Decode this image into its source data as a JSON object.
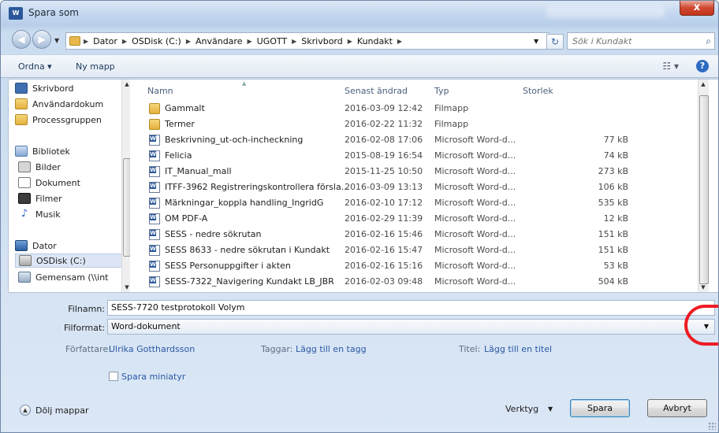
{
  "window": {
    "app_icon": "W",
    "title": "Spara som",
    "close_label": "x"
  },
  "address": {
    "crumbs": [
      "Dator",
      "OSDisk (C:)",
      "Användare",
      "UGOTT",
      "Skrivbord",
      "Kundakt"
    ],
    "search_placeholder": "Sök i Kundakt"
  },
  "toolbar": {
    "organize_label": "Ordna ▾",
    "new_folder_label": "Ny mapp"
  },
  "nav_pane": {
    "items": [
      {
        "label": "Skrivbord",
        "icon": "desktop-icon"
      },
      {
        "label": "Användardokum",
        "icon": "folder-icon"
      },
      {
        "label": "Processgruppen",
        "icon": "folder-icon"
      },
      {
        "label": "Bibliotek",
        "icon": "library-icon"
      },
      {
        "label": "Bilder",
        "icon": "pictures-icon"
      },
      {
        "label": "Dokument",
        "icon": "documents-icon"
      },
      {
        "label": "Filmer",
        "icon": "videos-icon"
      },
      {
        "label": "Musik",
        "icon": "music-icon"
      },
      {
        "label": "Dator",
        "icon": "computer-icon"
      },
      {
        "label": "OSDisk (C:)",
        "icon": "drive-icon",
        "selected": true
      },
      {
        "label": "Gemensam (\\\\int",
        "icon": "network-drive-icon"
      }
    ]
  },
  "file_list": {
    "columns": [
      "Namn",
      "Senast ändrad",
      "Typ",
      "Storlek"
    ],
    "rows": [
      {
        "name": "Gammalt",
        "date": "2016-03-09 12:42",
        "type": "Filmapp",
        "size": "",
        "kind": "folder"
      },
      {
        "name": "Termer",
        "date": "2016-02-22 11:32",
        "type": "Filmapp",
        "size": "",
        "kind": "folder"
      },
      {
        "name": "Beskrivning_ut-och-incheckning",
        "date": "2016-02-08 17:06",
        "type": "Microsoft Word-d...",
        "size": "77 kB",
        "kind": "word"
      },
      {
        "name": "Felicia",
        "date": "2015-08-19 16:54",
        "type": "Microsoft Word-d...",
        "size": "74 kB",
        "kind": "word"
      },
      {
        "name": "IT_Manual_mall",
        "date": "2015-11-25 10:50",
        "type": "Microsoft Word-d...",
        "size": "273 kB",
        "kind": "word"
      },
      {
        "name": "ITFF-3962 Registreringskontrollera försla...",
        "date": "2016-03-09 13:13",
        "type": "Microsoft Word-d...",
        "size": "106 kB",
        "kind": "word"
      },
      {
        "name": "Märkningar_koppla handling_IngridG",
        "date": "2016-02-10 17:12",
        "type": "Microsoft Word-d...",
        "size": "535 kB",
        "kind": "word"
      },
      {
        "name": "OM PDF-A",
        "date": "2016-02-29 11:39",
        "type": "Microsoft Word-d...",
        "size": "12 kB",
        "kind": "word"
      },
      {
        "name": "SESS - nedre sökrutan",
        "date": "2016-02-16 15:46",
        "type": "Microsoft Word-d...",
        "size": "151 kB",
        "kind": "word"
      },
      {
        "name": "SESS 8633 - nedre sökrutan i Kundakt",
        "date": "2016-02-16 15:47",
        "type": "Microsoft Word-d...",
        "size": "151 kB",
        "kind": "word"
      },
      {
        "name": "SESS Personuppgifter i akten",
        "date": "2016-02-16 15:16",
        "type": "Microsoft Word-d...",
        "size": "53 kB",
        "kind": "word"
      },
      {
        "name": "SESS-7322_Navigering Kundakt LB_JBR",
        "date": "2016-02-03 09:48",
        "type": "Microsoft Word-d...",
        "size": "504 kB",
        "kind": "word"
      }
    ]
  },
  "save_form": {
    "filename_label": "Filnamn:",
    "filename_value": "SESS-7720 testprotokoll Volym",
    "format_label": "Filformat:",
    "format_value": "Word-dokument",
    "authors_label": "Författare:",
    "authors_value": "Ulrika Gotthardsson",
    "tags_label": "Taggar:",
    "tags_value": "Lägg till en tagg",
    "title_label": "Titel:",
    "title_value": "Lägg till en titel",
    "thumbnail_label": "Spara miniatyr"
  },
  "footer": {
    "hide_folders_label": "Dölj mappar",
    "tools_label": "Verktyg",
    "save_label": "Spara",
    "cancel_label": "Avbryt"
  },
  "colors": {
    "annotation": "#ee1c24",
    "link": "#2a58a6"
  }
}
